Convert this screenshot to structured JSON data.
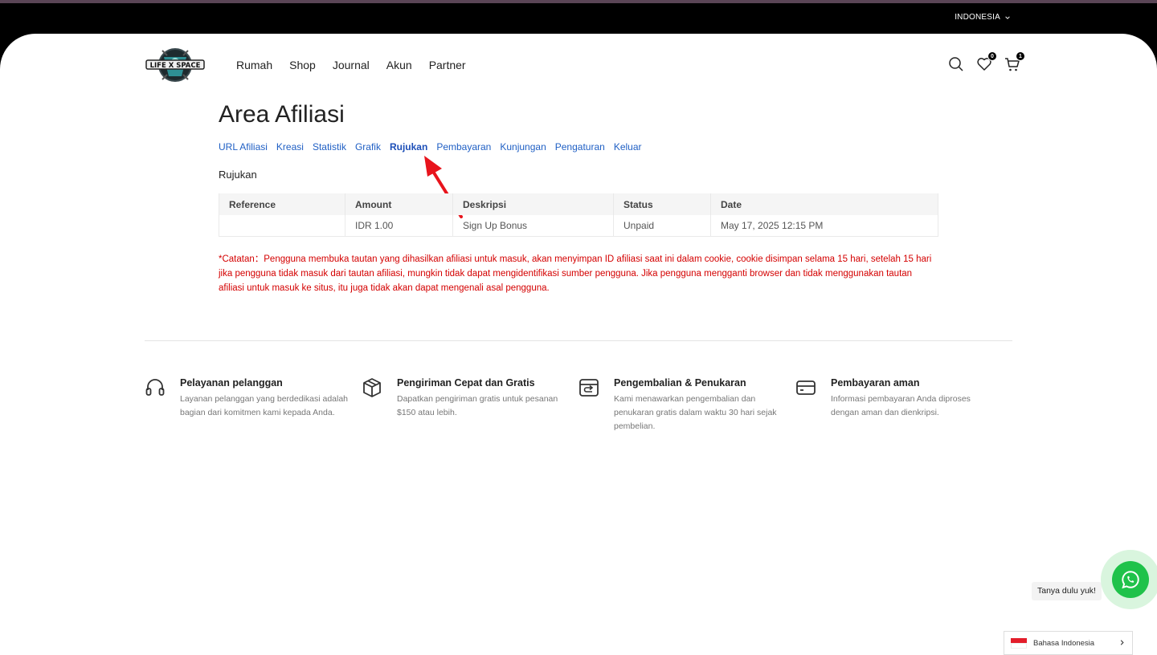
{
  "topbar": {
    "language": "INDONESIA"
  },
  "header": {
    "logo_alt": "LIFE X SPACE",
    "nav": [
      "Rumah",
      "Shop",
      "Journal",
      "Akun",
      "Partner"
    ],
    "wishlist_count": "0",
    "cart_count": "1"
  },
  "page": {
    "title": "Area Afiliasi",
    "tabs": [
      "URL Afiliasi",
      "Kreasi",
      "Statistik",
      "Grafik",
      "Rujukan",
      "Pembayaran",
      "Kunjungan",
      "Pengaturan",
      "Keluar"
    ],
    "active_tab": "Rujukan",
    "section_title": "Rujukan"
  },
  "table": {
    "headers": [
      "Reference",
      "Amount",
      "Deskripsi",
      "Status",
      "Date"
    ],
    "rows": [
      [
        "",
        "IDR 1.00",
        "Sign Up Bonus",
        "Unpaid",
        "May 17, 2025 12:15 PM"
      ]
    ]
  },
  "note": "*Catatan：Pengguna membuka tautan yang dihasilkan afiliasi untuk masuk, akan menyimpan ID afiliasi saat ini dalam cookie, cookie disimpan selama 15 hari, setelah 15 hari jika pengguna tidak masuk dari tautan afiliasi, mungkin tidak dapat mengidentifikasi sumber pengguna. Jika pengguna mengganti browser dan tidak menggunakan tautan afiliasi untuk masuk ke situs, itu juga tidak akan dapat mengenali asal pengguna.",
  "features": [
    {
      "icon": "headset-icon",
      "title": "Pelayanan pelanggan",
      "text": "Layanan pelanggan yang berdedikasi adalah bagian dari komitmen kami kepada Anda."
    },
    {
      "icon": "box-icon",
      "title": "Pengiriman Cepat dan Gratis",
      "text": "Dapatkan pengiriman gratis untuk pesanan $150 atau lebih."
    },
    {
      "icon": "return-icon",
      "title": "Pengembalian & Penukaran",
      "text": "Kami menawarkan pengembalian dan penukaran gratis dalam waktu 30 hari sejak pembelian."
    },
    {
      "icon": "card-icon",
      "title": "Pembayaran aman",
      "text": "Informasi pembayaran Anda diproses dengan aman dan dienkripsi."
    }
  ],
  "whatsapp": {
    "tooltip": "Tanya dulu yuk!"
  },
  "language_switcher": {
    "label": "Bahasa Indonesia"
  },
  "colors": {
    "link": "#1f5fc4",
    "note": "#d40000",
    "whatsapp": "#1fc24a"
  }
}
